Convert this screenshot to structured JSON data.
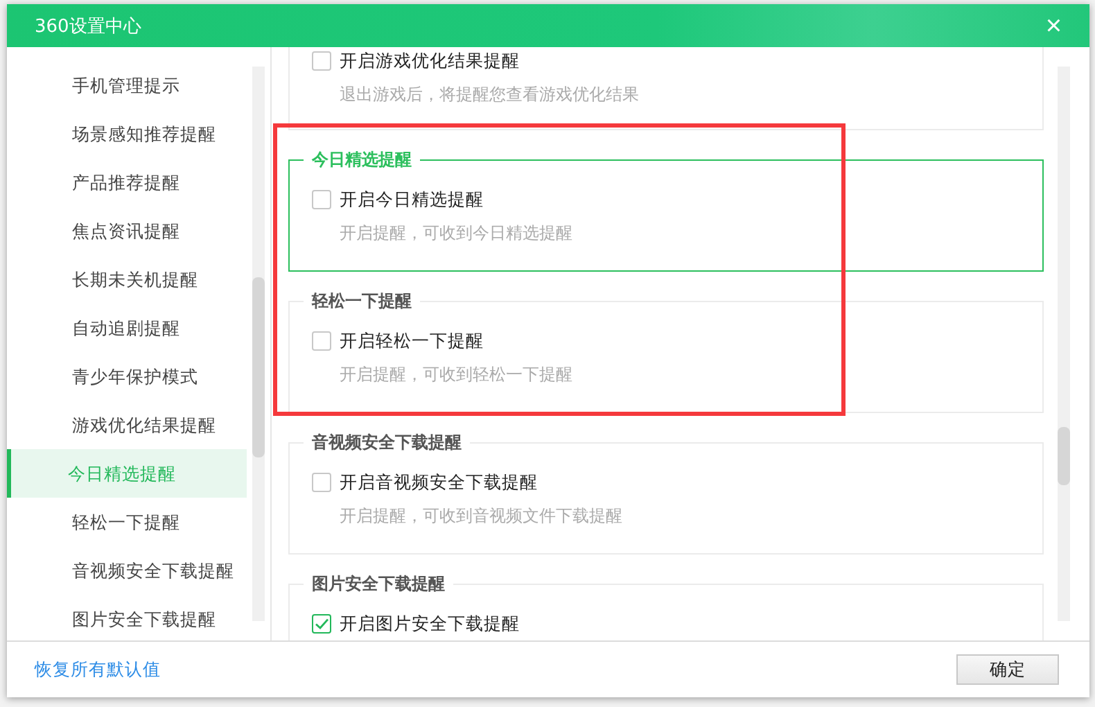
{
  "window": {
    "title": "360设置中心",
    "close": "×"
  },
  "sidebar": {
    "items": [
      {
        "label": "手机管理提示",
        "selected": false
      },
      {
        "label": "场景感知推荐提醒",
        "selected": false
      },
      {
        "label": "产品推荐提醒",
        "selected": false
      },
      {
        "label": "焦点资讯提醒",
        "selected": false
      },
      {
        "label": "长期未关机提醒",
        "selected": false
      },
      {
        "label": "自动追剧提醒",
        "selected": false
      },
      {
        "label": "青少年保护模式",
        "selected": false
      },
      {
        "label": "游戏优化结果提醒",
        "selected": false
      },
      {
        "label": "今日精选提醒",
        "selected": true
      },
      {
        "label": "轻松一下提醒",
        "selected": false
      },
      {
        "label": "音视频安全下载提醒",
        "selected": false
      },
      {
        "label": "图片安全下载提醒",
        "selected": false
      }
    ]
  },
  "sections": [
    {
      "option": "开启游戏优化结果提醒",
      "checked": false,
      "description": "退出游戏后，将提醒您查看游戏优化结果",
      "selected": false,
      "highlighted": false
    },
    {
      "title": "今日精选提醒",
      "option": "开启今日精选提醒",
      "checked": false,
      "description": "开启提醒，可收到今日精选提醒",
      "selected": true,
      "highlighted": true
    },
    {
      "title": "轻松一下提醒",
      "option": "开启轻松一下提醒",
      "checked": false,
      "description": "开启提醒，可收到轻松一下提醒",
      "selected": false,
      "highlighted": true
    },
    {
      "title": "音视频安全下载提醒",
      "option": "开启音视频安全下载提醒",
      "checked": false,
      "description": "开启提醒，可收到音视频文件下载提醒",
      "selected": false,
      "highlighted": false
    },
    {
      "title": "图片安全下载提醒",
      "option": "开启图片安全下载提醒",
      "checked": true,
      "selected": false,
      "highlighted": false
    }
  ],
  "footer": {
    "link": "恢复所有默认值",
    "button": "确定"
  }
}
